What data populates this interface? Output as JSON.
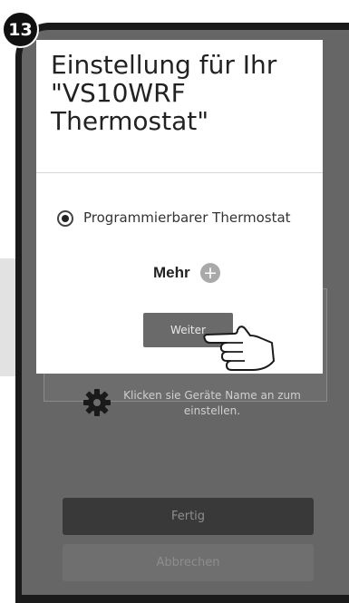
{
  "step_badge": "13",
  "dialog": {
    "title": "Einstellung für Ihr \"VS10WRF Thermostat\"",
    "radio_option": "Programmierbarer Thermostat",
    "more_label": "Mehr",
    "next_button": "Weiter"
  },
  "background": {
    "hint": "Klicken sie Geräte Name an zum einstellen.",
    "done_button": "Fertig",
    "cancel_button": "Abbrechen"
  },
  "icons": [
    "plus-icon",
    "gear-icon",
    "hand-pointer-icon"
  ]
}
